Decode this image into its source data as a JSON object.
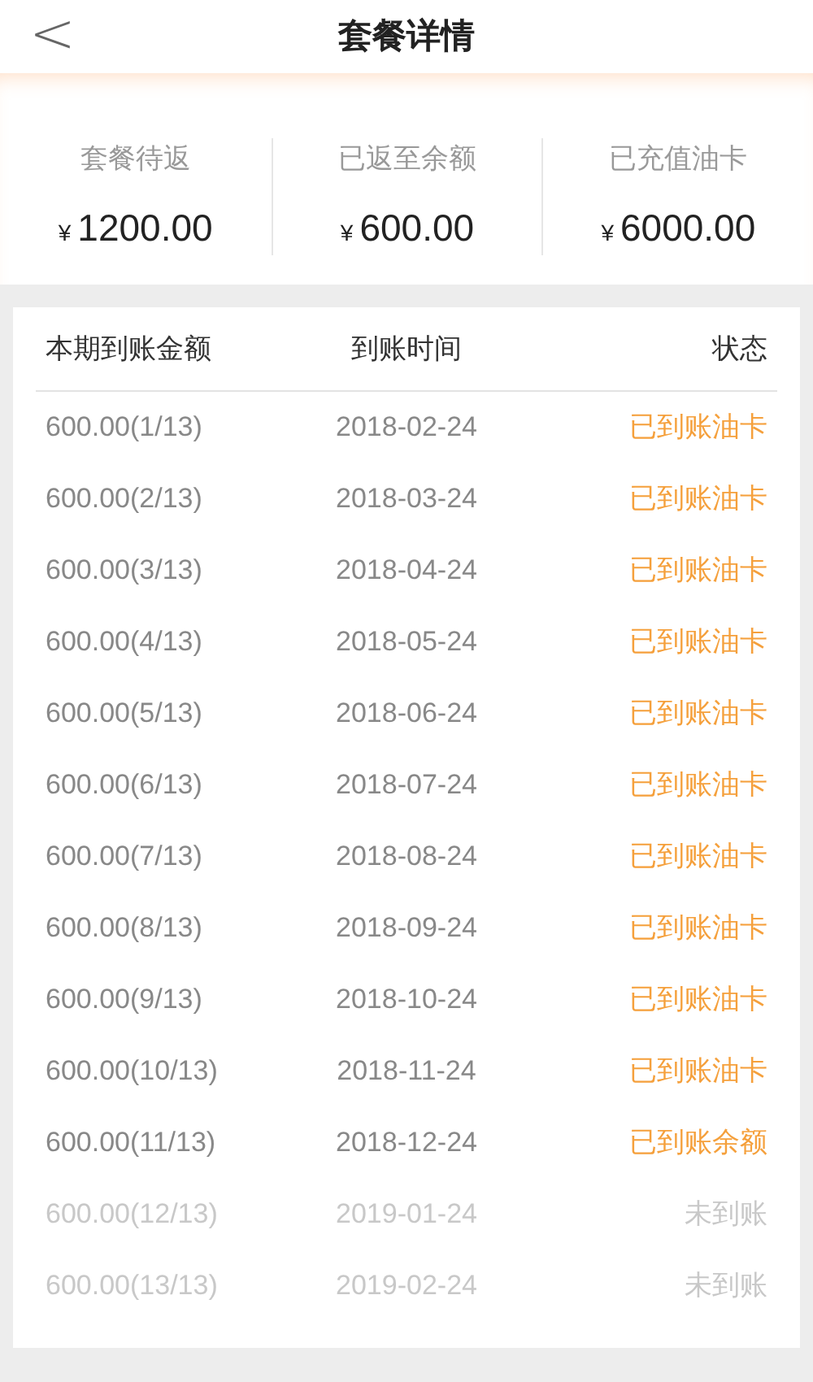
{
  "header": {
    "back": "<",
    "title": "套餐详情"
  },
  "summary": [
    {
      "label": "套餐待返",
      "currency": "¥",
      "amount": "1200.00"
    },
    {
      "label": "已返至余额",
      "currency": "¥",
      "amount": "600.00"
    },
    {
      "label": "已充值油卡",
      "currency": "¥",
      "amount": "6000.00"
    }
  ],
  "table": {
    "columns": [
      "本期到账金额",
      "到账时间",
      "状态"
    ],
    "rows": [
      {
        "amount": "600.00(1/13)",
        "date": "2018-02-24",
        "status": "已到账油卡",
        "received": true
      },
      {
        "amount": "600.00(2/13)",
        "date": "2018-03-24",
        "status": "已到账油卡",
        "received": true
      },
      {
        "amount": "600.00(3/13)",
        "date": "2018-04-24",
        "status": "已到账油卡",
        "received": true
      },
      {
        "amount": "600.00(4/13)",
        "date": "2018-05-24",
        "status": "已到账油卡",
        "received": true
      },
      {
        "amount": "600.00(5/13)",
        "date": "2018-06-24",
        "status": "已到账油卡",
        "received": true
      },
      {
        "amount": "600.00(6/13)",
        "date": "2018-07-24",
        "status": "已到账油卡",
        "received": true
      },
      {
        "amount": "600.00(7/13)",
        "date": "2018-08-24",
        "status": "已到账油卡",
        "received": true
      },
      {
        "amount": "600.00(8/13)",
        "date": "2018-09-24",
        "status": "已到账油卡",
        "received": true
      },
      {
        "amount": "600.00(9/13)",
        "date": "2018-10-24",
        "status": "已到账油卡",
        "received": true
      },
      {
        "amount": "600.00(10/13)",
        "date": "2018-11-24",
        "status": "已到账油卡",
        "received": true
      },
      {
        "amount": "600.00(11/13)",
        "date": "2018-12-24",
        "status": "已到账余额",
        "received": true
      },
      {
        "amount": "600.00(12/13)",
        "date": "2019-01-24",
        "status": "未到账",
        "received": false
      },
      {
        "amount": "600.00(13/13)",
        "date": "2019-02-24",
        "status": "未到账",
        "received": false
      }
    ]
  }
}
